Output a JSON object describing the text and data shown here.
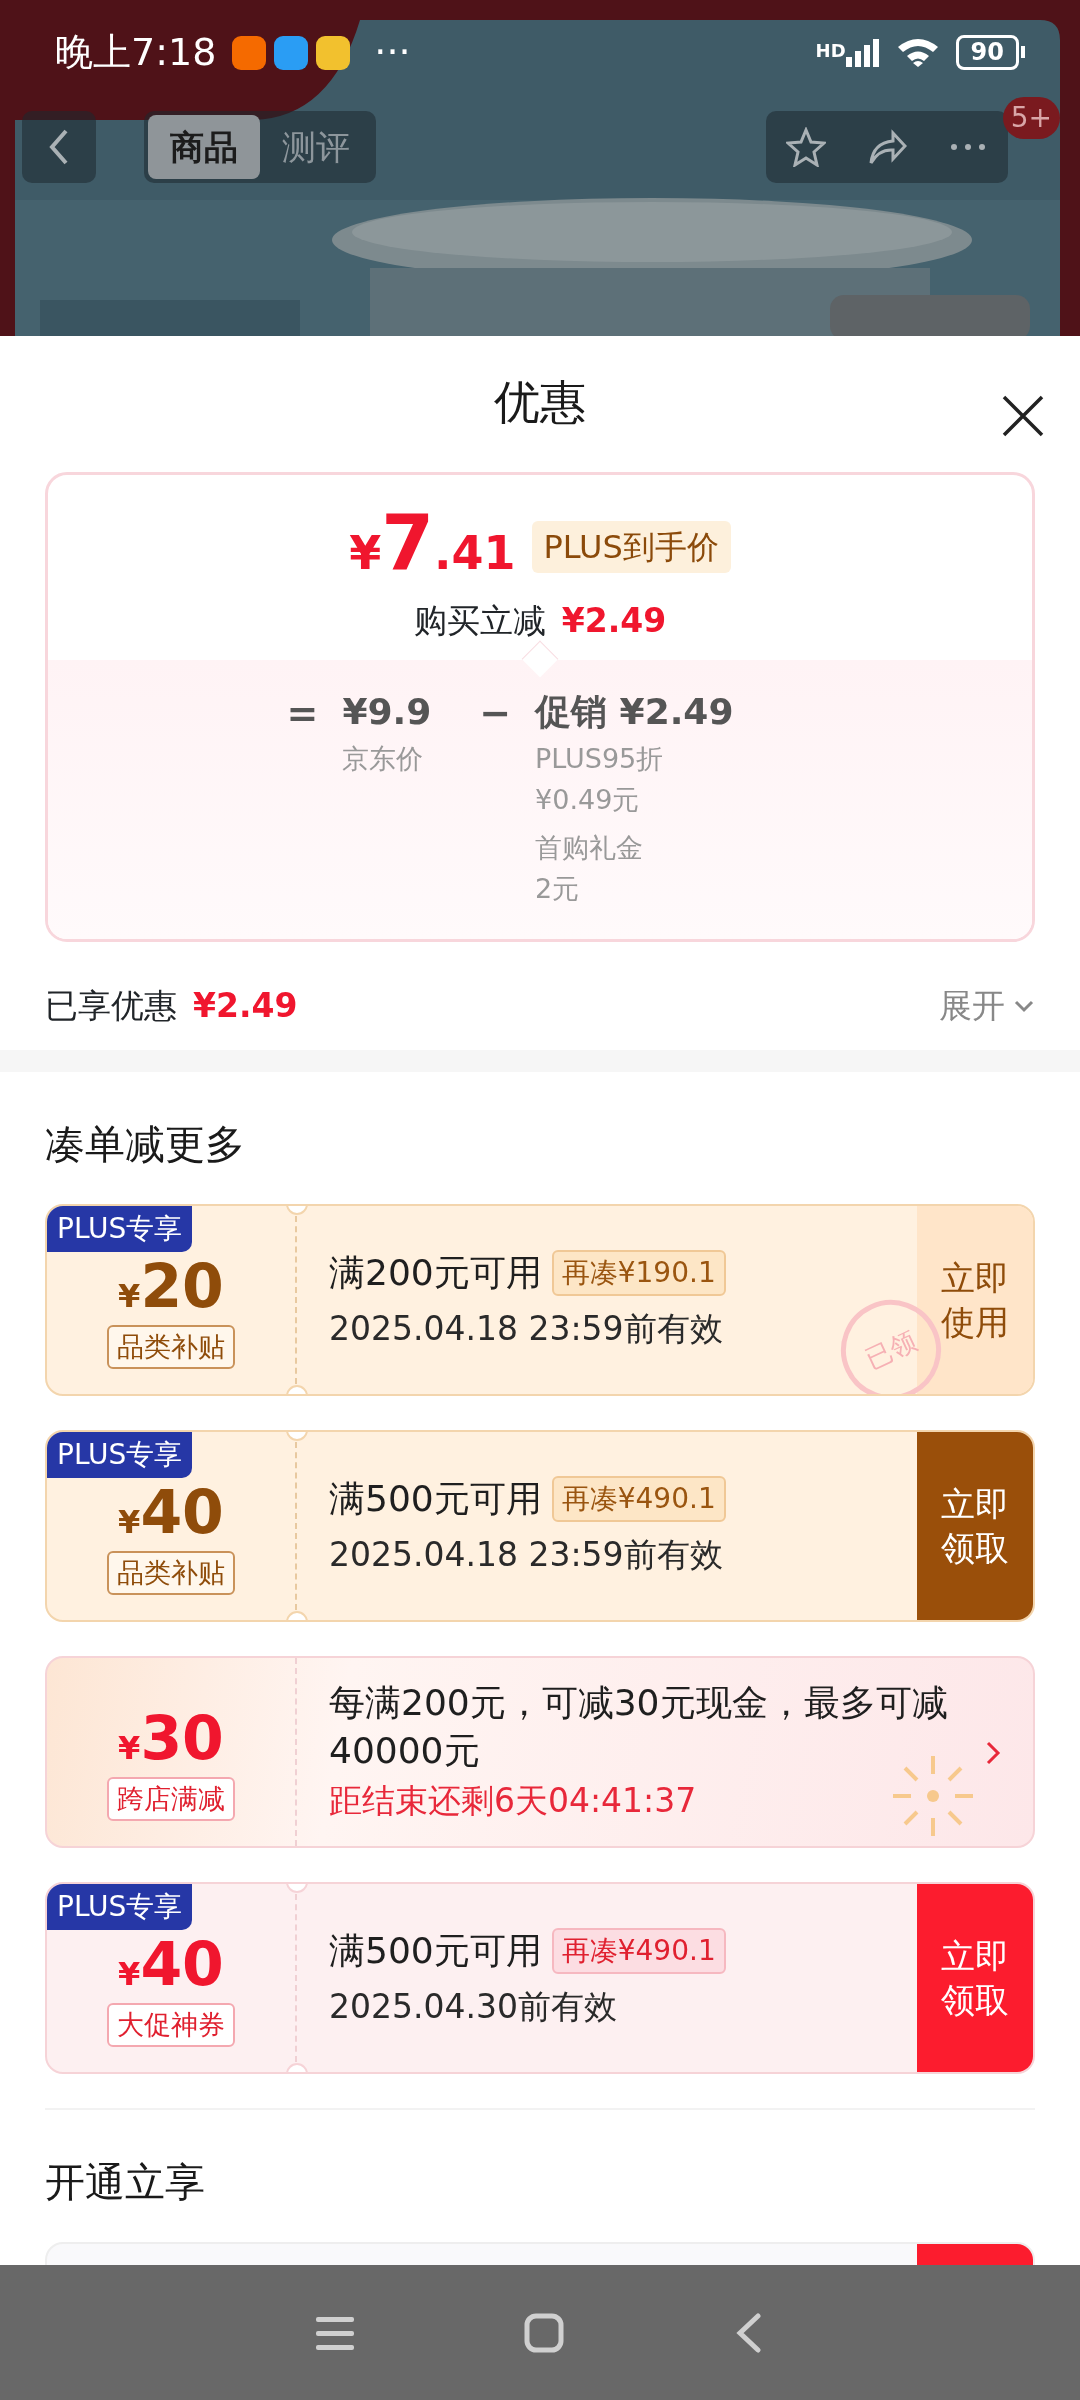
{
  "status_bar": {
    "time": "晚上7:18",
    "more": "···",
    "network": "HD",
    "battery": "90"
  },
  "top_nav": {
    "tabs": [
      {
        "label": "商品",
        "selected": true
      },
      {
        "label": "测评",
        "selected": false
      }
    ],
    "badge": "5+"
  },
  "sheet": {
    "title": "优惠",
    "price_card": {
      "currency": "¥",
      "price_int": "7",
      "price_dec": ".41",
      "tag": "PLUS到手价",
      "reduce_label": "购买立减",
      "reduce_value": "¥2.49",
      "equals": "=",
      "base_price": "¥9.9",
      "base_label": "京东价",
      "minus": "−",
      "promo_label": "促销 ¥2.49",
      "promo_details": [
        {
          "name": "PLUS95折",
          "amount": "¥0.49元"
        },
        {
          "name": "首购礼金",
          "amount": "2元"
        }
      ]
    },
    "summary": {
      "label": "已享优惠",
      "value": "¥2.49",
      "toggle": "展开"
    },
    "sections": [
      {
        "title": "凑单减更多",
        "items": [
          {
            "kind": "coupon",
            "color": "#8f4c0a",
            "badge": "PLUS专享",
            "currency": "¥",
            "amount": "20",
            "tag": "品类补贴",
            "condition": "满200元可用",
            "extra": "再凑¥190.1",
            "validity": "2025.04.18 23:59前有效",
            "action": "立即使用",
            "claimed": true,
            "stamp": "已领"
          },
          {
            "kind": "coupon",
            "color": "#8f4c0a",
            "badge": "PLUS专享",
            "currency": "¥",
            "amount": "40",
            "tag": "品类补贴",
            "condition": "满500元可用",
            "extra": "再凑¥490.1",
            "validity": "2025.04.18 23:59前有效",
            "action": "立即领取",
            "claimed": false
          },
          {
            "kind": "promo",
            "color": "#f0162e",
            "currency": "¥",
            "amount": "30",
            "tag": "跨店满减",
            "description": "每满200元，可减30元现金，最多可减40000元",
            "countdown": "距结束还剩6天04:41:37"
          },
          {
            "kind": "coupon",
            "color": "#f0162e",
            "badge": "PLUS专享",
            "currency": "¥",
            "amount": "40",
            "tag": "大促神券",
            "condition": "满500元可用",
            "extra": "再凑¥490.1",
            "validity": "2025.04.30前有效",
            "action": "立即领取",
            "claimed": false
          }
        ]
      },
      {
        "title": "开通立享",
        "items": [
          {
            "kind": "cut",
            "color": "#fc1c2e"
          }
        ]
      }
    ]
  }
}
